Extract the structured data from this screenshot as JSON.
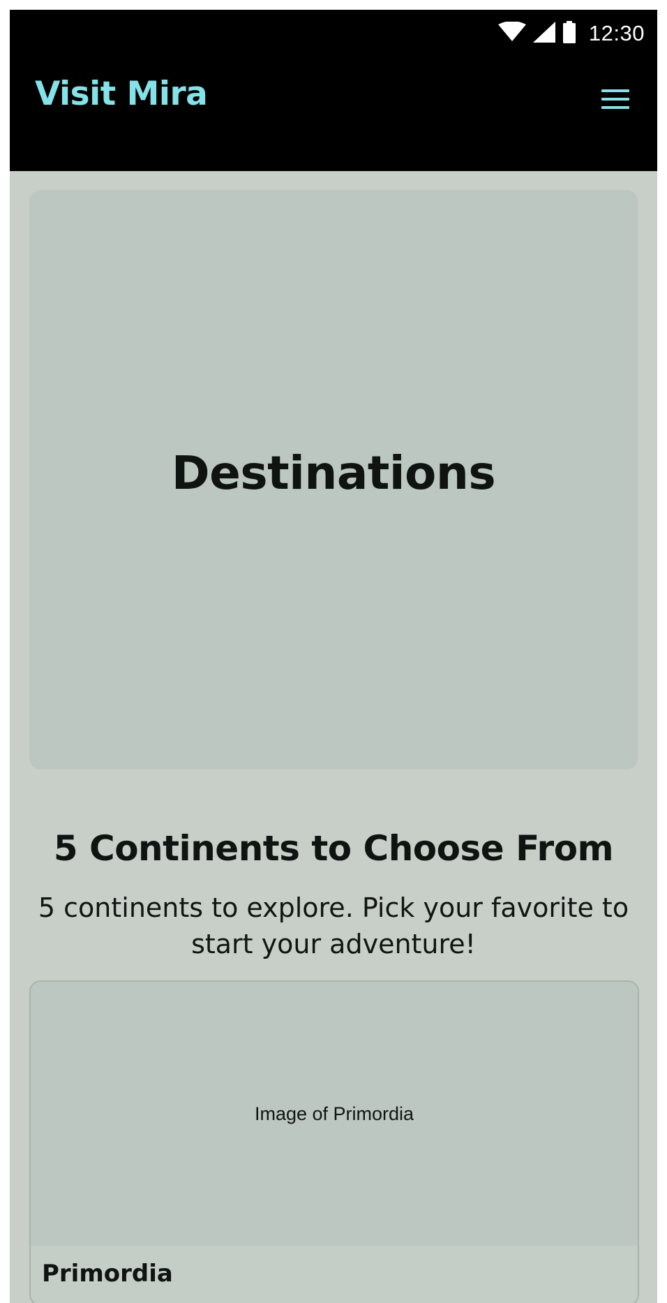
{
  "status_bar": {
    "time": "12:30",
    "icons": [
      "wifi-icon",
      "cell-signal-icon",
      "battery-icon"
    ]
  },
  "header": {
    "title": "Visit Mira",
    "menu_icon": "hamburger-menu-icon",
    "title_color": "#84e3e8",
    "background": "#000000"
  },
  "hero": {
    "title": "Destinations"
  },
  "continents_section": {
    "title": "5 Continents to Choose From",
    "description": "5 continents to explore. Pick your favorite to start your adventure!"
  },
  "cards": [
    {
      "image_alt": "Image of Primordia",
      "name": "Primordia"
    }
  ],
  "colors": {
    "page_background": "#c7cfc8",
    "placeholder_background": "#bdc7c1",
    "text": "#0f1412"
  }
}
